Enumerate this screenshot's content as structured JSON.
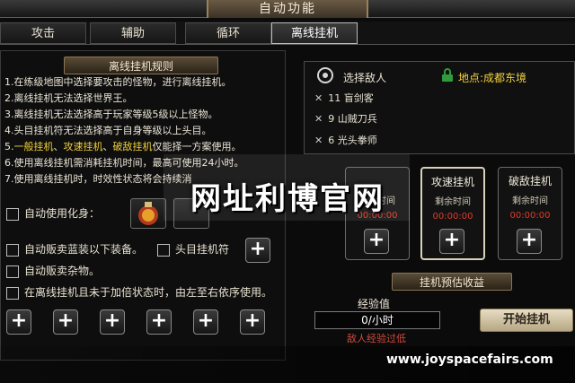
{
  "window": {
    "title": "自动功能"
  },
  "tabs": [
    {
      "label": "攻击",
      "active": false
    },
    {
      "label": "辅助",
      "active": false
    },
    {
      "label": "循环",
      "active": false
    },
    {
      "label": "离线挂机",
      "active": true
    }
  ],
  "rules": {
    "heading": "离线挂机规则",
    "lines": [
      "1.在练级地图中选择要攻击的怪物，进行离线挂机。",
      "2.离线挂机无法选择世界王。",
      "3.离线挂机无法选择高于玩家等级5级以上怪物。",
      "4.头目挂机符无法选择高于自身等级以上头目。",
      "6.使用离线挂机需消耗挂机时间，最高可使用24小时。",
      "7.使用离线挂机时，时效性状态将会持续消"
    ],
    "line5": {
      "num": "5.",
      "opt1": "一般挂机",
      "sep1": "、",
      "opt2": "攻速挂机",
      "sep2": "、",
      "opt3": "破敌挂机",
      "rest": "仅能择一方案使用。"
    }
  },
  "options": {
    "auto_transform": "自动使用化身：",
    "auto_sell_blue": "自动贩卖蓝装以下装备。",
    "boss_charm": "头目挂机符",
    "auto_sell_misc": "自动贩卖杂物。",
    "buff_order": "在离线挂机且未于加倍状态时，由左至右依序使用。"
  },
  "enemy": {
    "title": "选择敌人",
    "map": "地点:成都东境",
    "list": [
      {
        "level": "11",
        "name": "盲剑客"
      },
      {
        "level": "9",
        "name": "山贼刀兵"
      },
      {
        "level": "6",
        "name": "光头拳师"
      }
    ]
  },
  "modes": [
    {
      "title": "",
      "sub": "剩余时间",
      "time": "00:00:00",
      "selected": false
    },
    {
      "title": "攻速挂机",
      "sub": "剩余时间",
      "time": "00:00:00",
      "selected": true
    },
    {
      "title": "破敌挂机",
      "sub": "剩余时间",
      "time": "00:00:00",
      "selected": false
    }
  ],
  "estimate": {
    "heading": "挂机预估收益",
    "exp_label": "经验值",
    "exp_value": "0/小时",
    "warning": "敌人经验过低",
    "start_button": "开始挂机"
  },
  "overlay": {
    "watermark": "网址利博官网",
    "url": "www.joyspacefairs.com"
  },
  "colors": {
    "highlight": "#f2d23b",
    "time_red": "#e03a2a",
    "panel_border": "#8b7650"
  }
}
